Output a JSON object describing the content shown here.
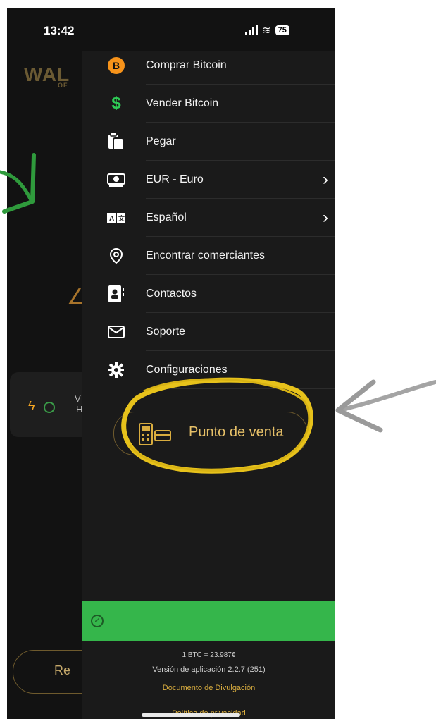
{
  "status_bar": {
    "time": "13:42",
    "battery": "75"
  },
  "background_app": {
    "logo": "WAL",
    "logo_sub": "OF",
    "card_text": "V",
    "card_text2": "H",
    "bottom_button": "Re"
  },
  "menu": {
    "items": [
      {
        "label": "Comprar Bitcoin",
        "icon": "bitcoin-icon",
        "chevron": false
      },
      {
        "label": "Vender Bitcoin",
        "icon": "dollar-icon",
        "chevron": false
      },
      {
        "label": "Pegar",
        "icon": "paste-icon",
        "chevron": false
      },
      {
        "label": "EUR - Euro",
        "icon": "currency-icon",
        "chevron": true
      },
      {
        "label": "Español",
        "icon": "language-icon",
        "chevron": true
      },
      {
        "label": "Encontrar comerciantes",
        "icon": "location-pin-icon",
        "chevron": false
      },
      {
        "label": "Contactos",
        "icon": "contacts-icon",
        "chevron": false
      },
      {
        "label": "Soporte",
        "icon": "mail-icon",
        "chevron": false
      },
      {
        "label": "Configuraciones",
        "icon": "gear-icon",
        "chevron": false
      }
    ],
    "pos_button": "Punto de venta"
  },
  "footer": {
    "rate": "1 BTC = 23.987€",
    "version": "Versión de aplicación 2.2.7 (251)",
    "disclosure_link": "Documento de Divulgación",
    "privacy_link": "Política de privacidad"
  },
  "colors": {
    "accent": "#d9ad3f",
    "success": "#35b64b",
    "drawer": "#1a1a1a",
    "annotation": "#e7c21b"
  }
}
